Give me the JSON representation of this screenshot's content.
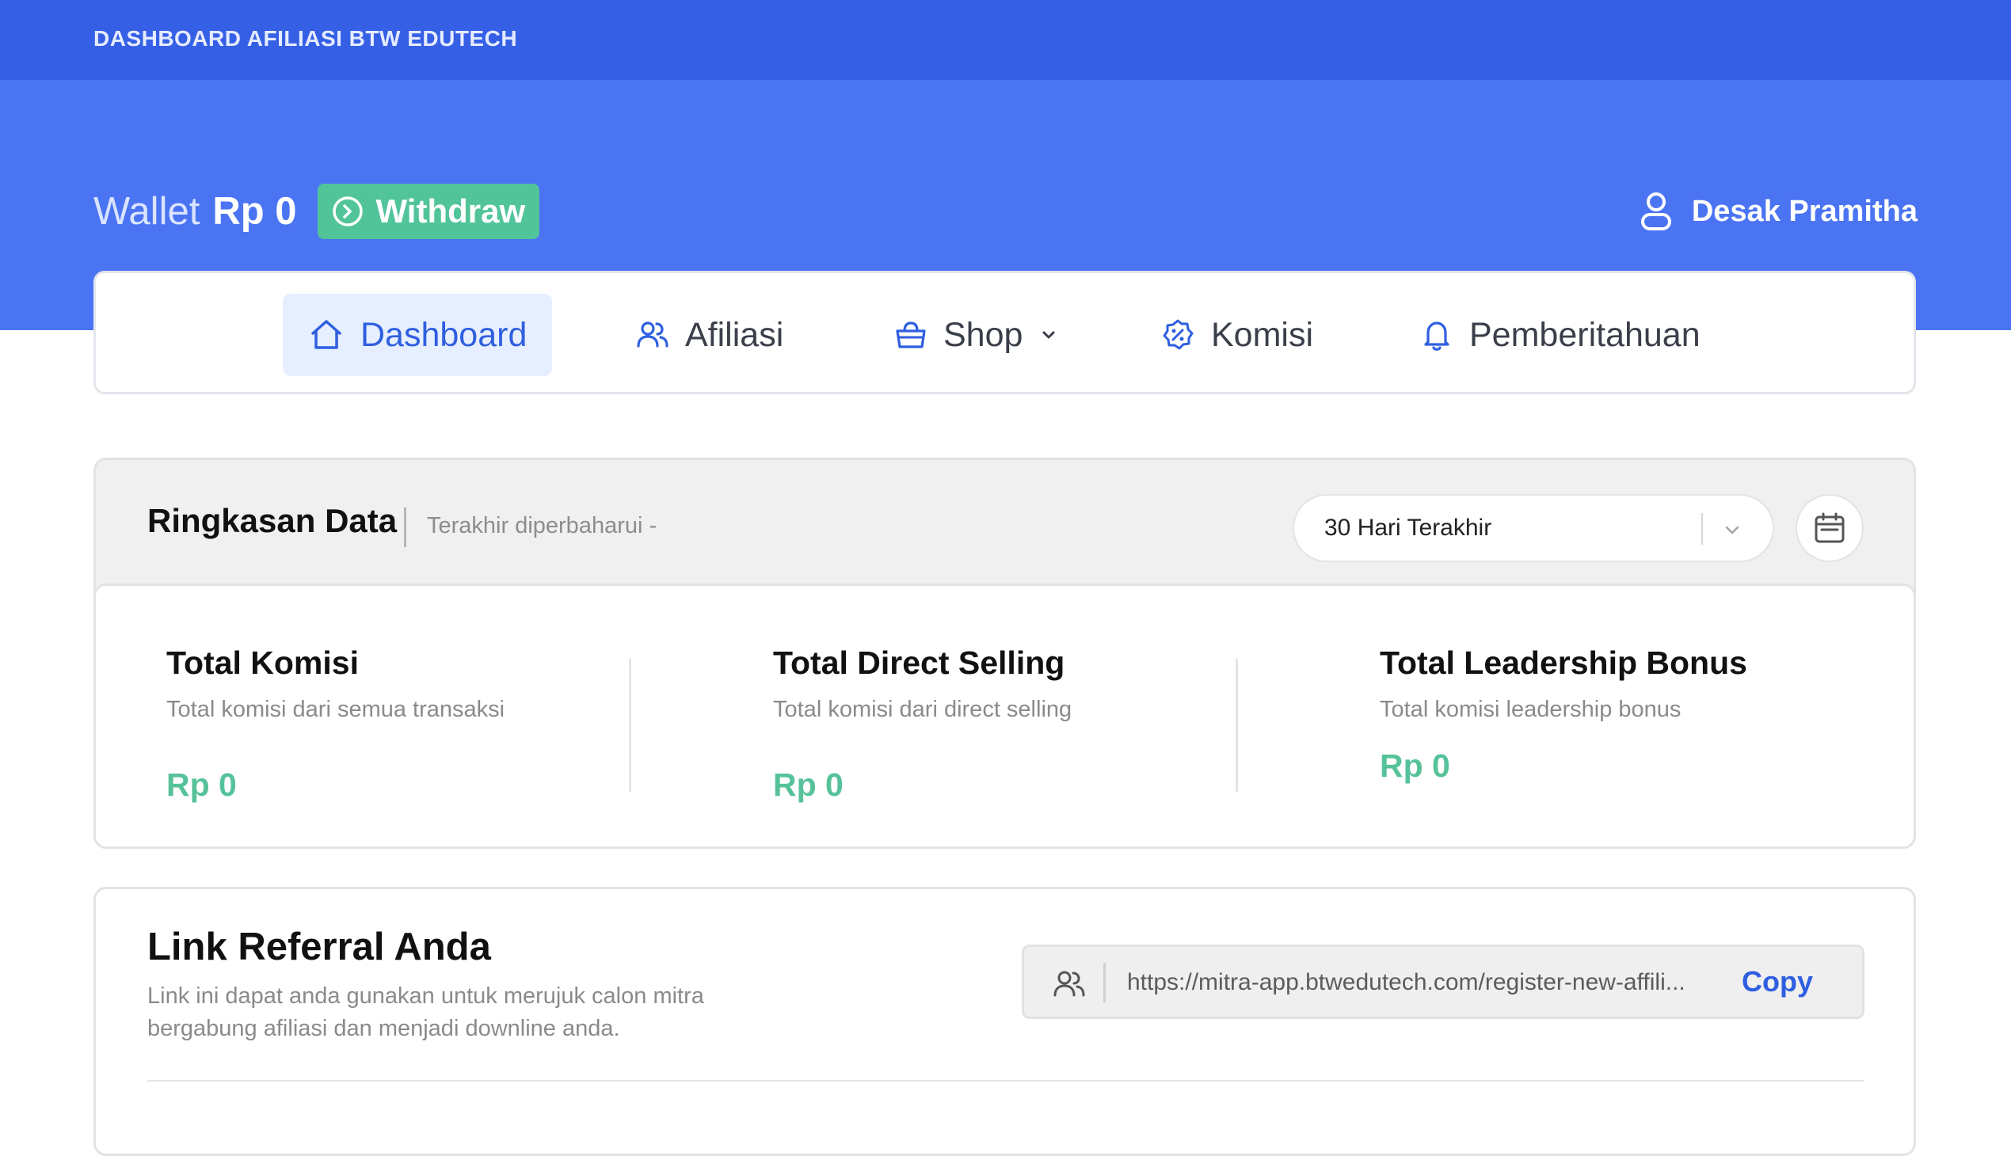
{
  "header": {
    "brand": "DASHBOARD AFILIASI BTW EDUTECH"
  },
  "wallet": {
    "label": "Wallet",
    "amount": "Rp 0",
    "withdraw_label": "Withdraw"
  },
  "user": {
    "name": "Desak Pramitha"
  },
  "nav": {
    "items": [
      {
        "label": "Dashboard",
        "icon": "home-icon",
        "active": true
      },
      {
        "label": "Afiliasi",
        "icon": "users-icon"
      },
      {
        "label": "Shop",
        "icon": "basket-icon",
        "has_dropdown": true
      },
      {
        "label": "Komisi",
        "icon": "discount-badge-icon"
      },
      {
        "label": "Pemberitahuan",
        "icon": "bell-icon"
      }
    ]
  },
  "summary": {
    "title": "Ringkasan Data",
    "updated": "Terakhir diperbaharui -",
    "period": "30 Hari Terakhir",
    "stats": [
      {
        "title": "Total Komisi",
        "desc": "Total komisi dari semua transaksi",
        "value": "Rp 0"
      },
      {
        "title": "Total Direct Selling",
        "desc": "Total komisi dari direct selling",
        "value": "Rp 0"
      },
      {
        "title": "Total Leadership Bonus",
        "desc": "Total komisi leadership bonus",
        "value": "Rp 0"
      }
    ]
  },
  "referral": {
    "title": "Link Referral Anda",
    "desc": "Link ini dapat anda gunakan untuk merujuk calon mitra bergabung afiliasi dan menjadi downline anda.",
    "url": "https://mitra-app.btwedutech.com/register-new-affili...",
    "copy_label": "Copy"
  },
  "colors": {
    "primary": "#3560e6",
    "hero": "#4a74f2",
    "success": "#52c49a",
    "nav_active_bg": "#e6efff"
  }
}
